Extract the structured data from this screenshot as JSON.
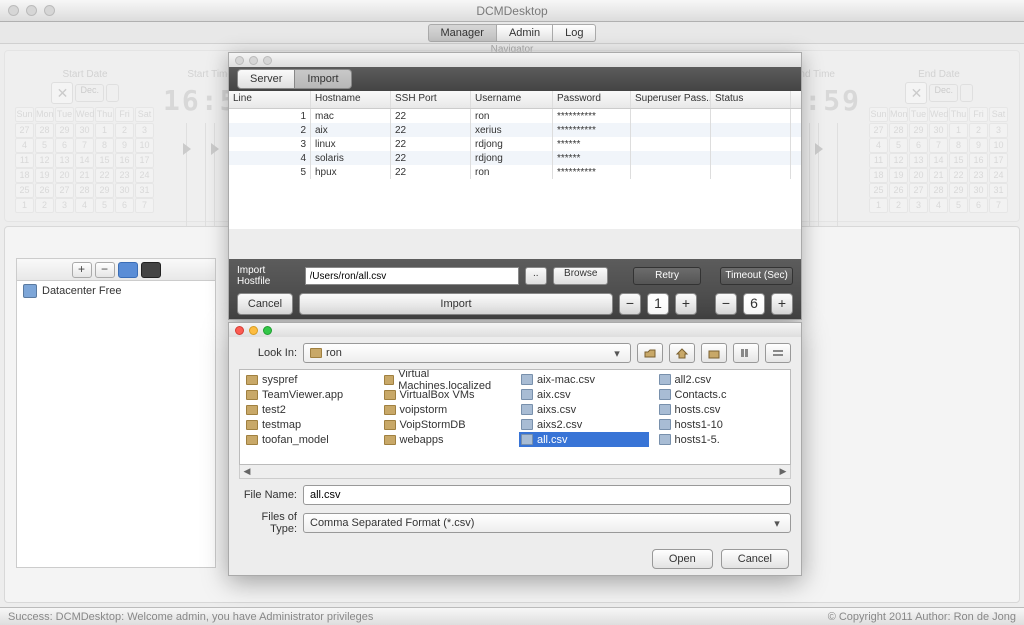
{
  "app_title": "DCMDesktop",
  "menubar": {
    "items": [
      "Manager",
      "Admin",
      "Log"
    ],
    "active": 0
  },
  "navigator_label": "Navigator",
  "panels": {
    "start_date": "Start Date",
    "start_time": "Start Time",
    "end_time": "End Time",
    "end_date": "End Date",
    "month": "Dec.",
    "days": [
      "Sun",
      "Mon",
      "Tue",
      "Wed",
      "Thu",
      "Fri",
      "Sat"
    ],
    "clock": "16:59",
    "clock_end": "17:59"
  },
  "tree": {
    "buttons": [
      "+",
      "−"
    ],
    "root": "Datacenter Free"
  },
  "import_win": {
    "tabs": [
      "Server",
      "Import"
    ],
    "active_tab": 1,
    "columns": [
      "Line",
      "Hostname",
      "SSH Port",
      "Username",
      "Password",
      "Superuser Pass...",
      "Status"
    ],
    "rows": [
      {
        "line": "1",
        "host": "mac",
        "port": "22",
        "user": "ron",
        "pw": "**********"
      },
      {
        "line": "2",
        "host": "aix",
        "port": "22",
        "user": "xerius",
        "pw": "**********"
      },
      {
        "line": "3",
        "host": "linux",
        "port": "22",
        "user": "rdjong",
        "pw": "******"
      },
      {
        "line": "4",
        "host": "solaris",
        "port": "22",
        "user": "rdjong",
        "pw": "******"
      },
      {
        "line": "5",
        "host": "hpux",
        "port": "22",
        "user": "ron",
        "pw": "**********"
      }
    ],
    "hostfile_label": "Import Hostfile",
    "hostfile_value": "/Users/ron/all.csv",
    "dots_btn": "..",
    "browse_btn": "Browse",
    "retry_btn": "Retry",
    "timeout_btn": "Timeout (Sec)",
    "cancel_btn": "Cancel",
    "import_btn": "Import",
    "spin_left": "1",
    "spin_right": "6"
  },
  "file_dlg": {
    "lookin_label": "Look In:",
    "lookin_value": "ron",
    "cols": [
      [
        {
          "n": "syspref",
          "d": true
        },
        {
          "n": "TeamViewer.app",
          "d": true
        },
        {
          "n": "test2",
          "d": true
        },
        {
          "n": "testmap",
          "d": true
        },
        {
          "n": "toofan_model",
          "d": true
        }
      ],
      [
        {
          "n": "Virtual Machines.localized",
          "d": true
        },
        {
          "n": "VirtualBox VMs",
          "d": true
        },
        {
          "n": "voipstorm",
          "d": true
        },
        {
          "n": "VoipStormDB",
          "d": true
        },
        {
          "n": "webapps",
          "d": true
        }
      ],
      [
        {
          "n": "aix-mac.csv",
          "d": false
        },
        {
          "n": "aix.csv",
          "d": false
        },
        {
          "n": "aixs.csv",
          "d": false
        },
        {
          "n": "aixs2.csv",
          "d": false
        },
        {
          "n": "all.csv",
          "d": false,
          "sel": true
        }
      ],
      [
        {
          "n": "all2.csv",
          "d": false
        },
        {
          "n": "Contacts.c",
          "d": false
        },
        {
          "n": "hosts.csv",
          "d": false
        },
        {
          "n": "hosts1-10",
          "d": false
        },
        {
          "n": "hosts1-5.",
          "d": false
        }
      ]
    ],
    "filename_label": "File Name:",
    "filename_value": "all.csv",
    "filetype_label": "Files of Type:",
    "filetype_value": "Comma Separated Format (*.csv)",
    "open_btn": "Open",
    "cancel_btn": "Cancel"
  },
  "status": {
    "left": "Success: DCMDesktop: Welcome admin, you have Administrator privileges",
    "right": "© Copyright 2011 Author: Ron de Jong"
  }
}
